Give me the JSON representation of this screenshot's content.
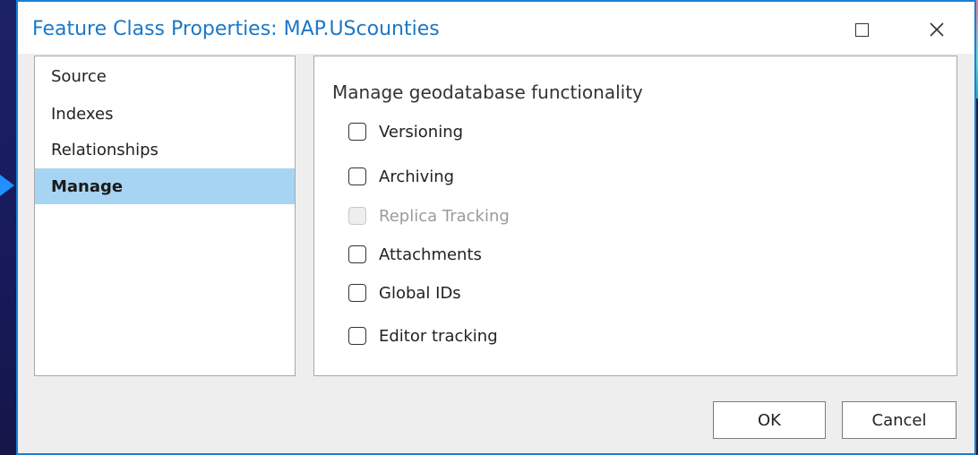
{
  "window": {
    "title": "Feature Class Properties: MAP.UScounties",
    "maximize_icon": "maximize-icon",
    "close_icon": "close-icon"
  },
  "sidebar": {
    "items": [
      {
        "label": "Source",
        "selected": false
      },
      {
        "label": "Indexes",
        "selected": false
      },
      {
        "label": "Relationships",
        "selected": false
      },
      {
        "label": "Manage",
        "selected": true
      }
    ]
  },
  "main": {
    "section_title": "Manage geodatabase functionality",
    "options": [
      {
        "label": "Versioning",
        "checked": false,
        "enabled": true
      },
      {
        "label": "Archiving",
        "checked": false,
        "enabled": true
      },
      {
        "label": "Replica Tracking",
        "checked": false,
        "enabled": false
      },
      {
        "label": "Attachments",
        "checked": false,
        "enabled": true
      },
      {
        "label": "Global IDs",
        "checked": false,
        "enabled": true
      },
      {
        "label": "Editor tracking",
        "checked": false,
        "enabled": true
      }
    ]
  },
  "footer": {
    "ok_label": "OK",
    "cancel_label": "Cancel"
  },
  "colors": {
    "accent": "#1a78c8",
    "selection": "#a7d4f2",
    "dialog_bg": "#eeeeee"
  }
}
